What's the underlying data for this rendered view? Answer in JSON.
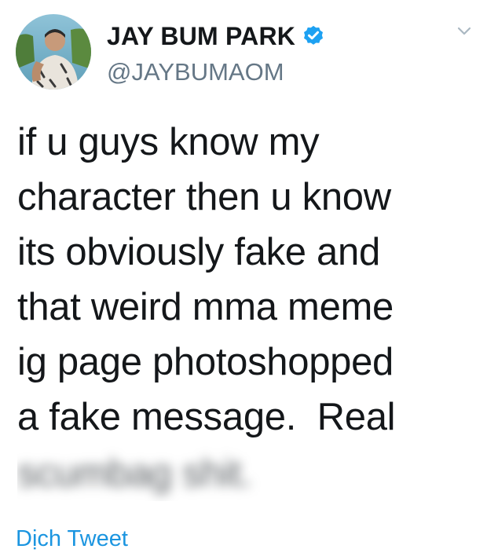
{
  "author": {
    "display_name": "JAY BUM PARK",
    "handle": "@JAYBUMAOM",
    "verified": true
  },
  "tweet": {
    "lines": [
      "if u guys know my",
      "character then u know",
      "its obviously fake and",
      "that weird mma meme",
      "ig page photoshopped",
      "a fake message.  Real"
    ],
    "blurred_line": "scumbag shit."
  },
  "actions": {
    "translate_label": "Dịch Tweet"
  },
  "icons": {
    "verified": "verified-badge-icon",
    "menu": "chevron-down-icon"
  },
  "colors": {
    "text": "#14171a",
    "secondary": "#657786",
    "link": "#1b95e0",
    "verified": "#1da1f2"
  }
}
